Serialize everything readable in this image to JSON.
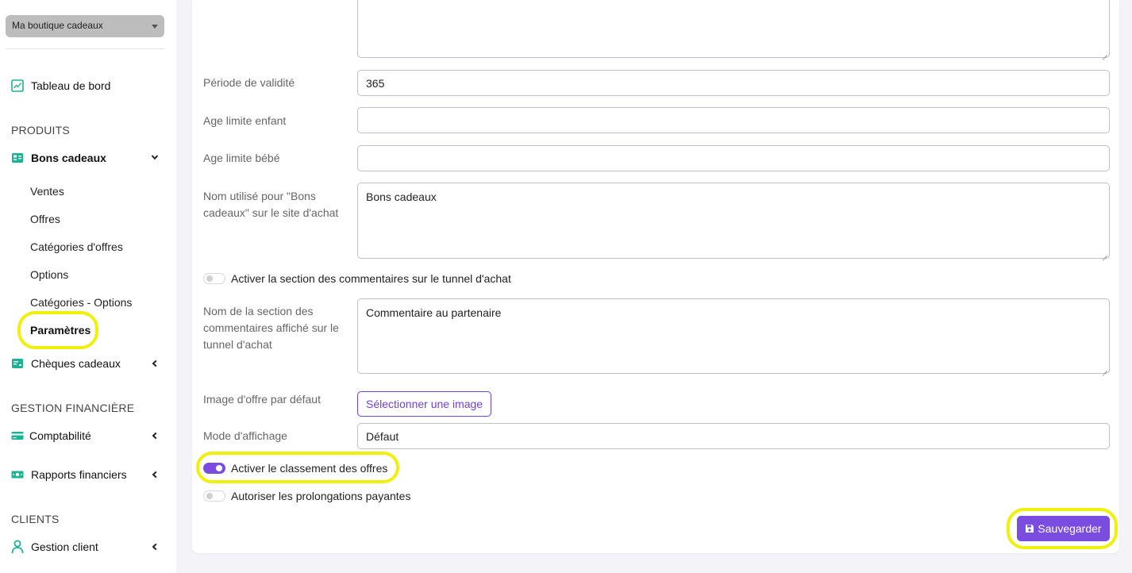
{
  "shop_selector": {
    "value": "Ma boutique cadeaux"
  },
  "sidebar": {
    "dashboard": "Tableau de bord",
    "sections": {
      "products": "PRODUITS",
      "finance": "GESTION FINANCIÈRE",
      "clients": "CLIENTS"
    },
    "gift_vouchers": {
      "label": "Bons cadeaux",
      "children": [
        "Ventes",
        "Offres",
        "Catégories d'offres",
        "Options",
        "Catégories - Options",
        "Paramètres"
      ]
    },
    "gift_cheques": "Chèques cadeaux",
    "accounting": "Comptabilité",
    "financial_reports": "Rapports financiers",
    "client_management": "Gestion client",
    "active_item": "Paramètres"
  },
  "form": {
    "validity_period": {
      "label": "Période de validité",
      "value": "365"
    },
    "child_age_limit": {
      "label": "Age limite enfant",
      "value": ""
    },
    "baby_age_limit": {
      "label": "Age limite bébé",
      "value": ""
    },
    "name_for_vouchers": {
      "label": "Nom utilisé pour \"Bons cadeaux\" sur le site d'achat",
      "value": "Bons cadeaux"
    },
    "toggle_comments": {
      "label": "Activer la section des commentaires sur le tunnel d'achat",
      "on": false
    },
    "comments_section_name": {
      "label": "Nom de la section des commentaires affiché sur le tunnel d'achat",
      "value": "Commentaire au partenaire"
    },
    "default_offer_image": {
      "label": "Image d'offre par défaut",
      "button": "Sélectionner une image"
    },
    "display_mode": {
      "label": "Mode d'affichage",
      "value": "Défaut"
    },
    "toggle_ranking": {
      "label": "Activer le classement des offres",
      "on": true
    },
    "toggle_extensions": {
      "label": "Autoriser les prolongations payantes",
      "on": false
    },
    "save_button": "Sauvegarder"
  },
  "colors": {
    "accent": "#7b4ce0",
    "highlight": "#f0f00a",
    "icon_teal": "#1ab394"
  },
  "icons": {
    "dashboard": "chart-line-icon",
    "gift_vouchers": "voucher-icon",
    "gift_cheques": "cheque-icon",
    "accounting": "credit-card-icon",
    "financial_reports": "money-icon",
    "client_management": "user-icon",
    "save": "floppy-disk-icon"
  }
}
